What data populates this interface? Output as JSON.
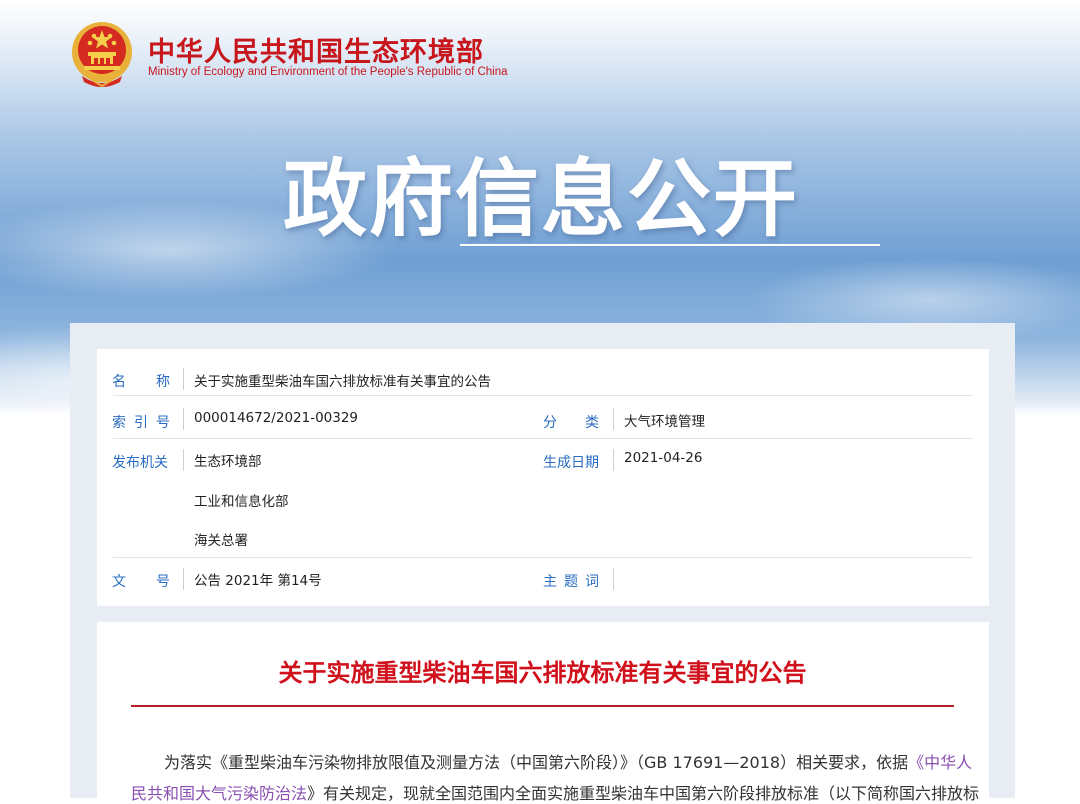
{
  "header": {
    "site_name_cn": "中华人民共和国生态环境部",
    "site_name_en": "Ministry of Ecology and Environment of the People's Republic of China",
    "section_title": "政府信息公开"
  },
  "meta": {
    "name": {
      "label": "名称",
      "value": "关于实施重型柴油车国六排放标准有关事宜的公告"
    },
    "index_no": {
      "label": "索引号",
      "value": "000014672/2021-00329"
    },
    "category": {
      "label": "分类",
      "value": "大气环境管理"
    },
    "issuer": {
      "label": "发布机关",
      "values": [
        "生态环境部",
        "工业和信息化部",
        "海关总署"
      ]
    },
    "date": {
      "label": "生成日期",
      "value": "2021-04-26"
    },
    "doc_no": {
      "label": "文号",
      "value": "公告 2021年 第14号"
    },
    "keywords": {
      "label": "主题词",
      "value": ""
    }
  },
  "article": {
    "title": "关于实施重型柴油车国六排放标准有关事宜的公告",
    "line1_a": "为落实《重型柴油车污染物排放限值及测量方法（中国第六阶段）》（GB 17691—2018）相关要求，依据",
    "line1_link": "《中华人",
    "line2_link": "民共和国大气污染防治法",
    "line2_b": "》有关规定，现就全国范围内全面实施重型柴油车中国第六阶段排放标准（以下简称国六排放标"
  },
  "colors": {
    "brand_red": "#c8161d",
    "label_blue": "#2a6cc0",
    "link_purple": "#8a4fb3"
  }
}
